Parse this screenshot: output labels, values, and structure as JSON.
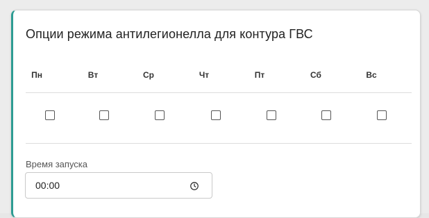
{
  "card": {
    "title": "Опции режима антилегионелла для контура ГВС"
  },
  "days": [
    {
      "label": "Пн",
      "checked": false
    },
    {
      "label": "Вт",
      "checked": false
    },
    {
      "label": "Ср",
      "checked": false
    },
    {
      "label": "Чт",
      "checked": false
    },
    {
      "label": "Пт",
      "checked": false
    },
    {
      "label": "Сб",
      "checked": false
    },
    {
      "label": "Вс",
      "checked": false
    }
  ],
  "start_time": {
    "label": "Время запуска",
    "value": "00:00",
    "icon": "clock-icon"
  },
  "colors": {
    "accent": "#2d9c93",
    "divider": "#dddddd"
  }
}
